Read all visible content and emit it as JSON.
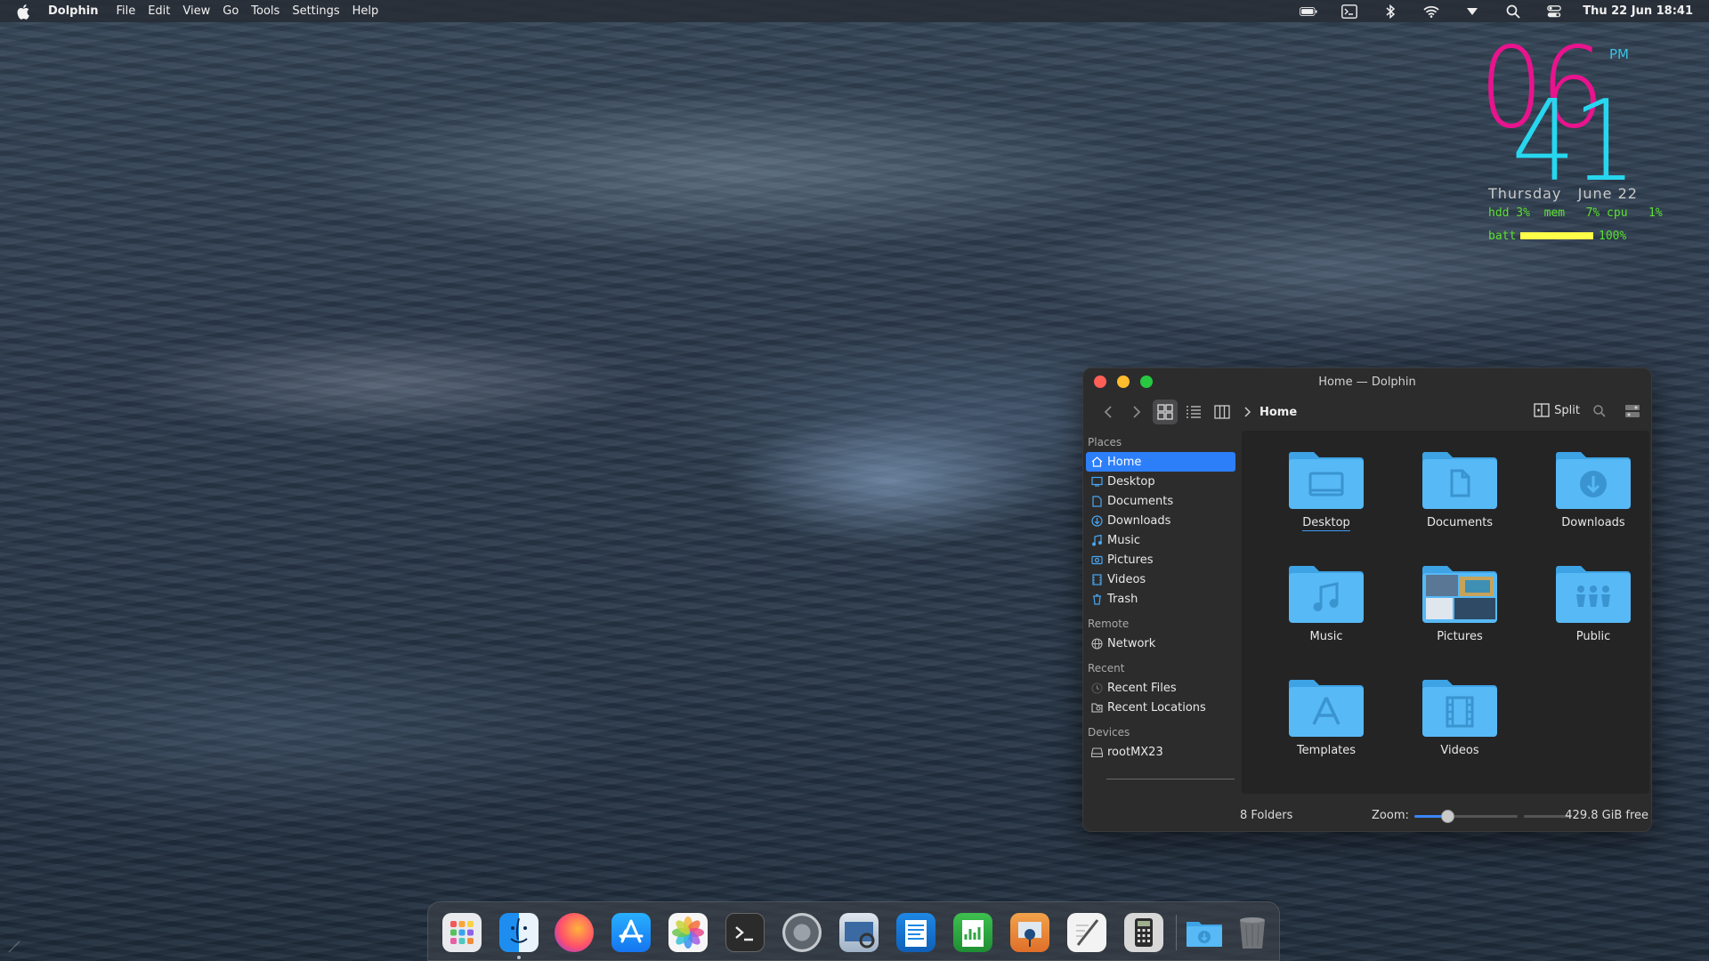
{
  "menubar": {
    "app_name": "Dolphin",
    "menus": [
      "File",
      "Edit",
      "View",
      "Go",
      "Tools",
      "Settings",
      "Help"
    ],
    "status_icons": [
      "battery-icon",
      "terminal-icon",
      "bluetooth-icon",
      "wifi-icon",
      "dropdown-arrow-icon",
      "search-icon",
      "control-center-icon"
    ],
    "clock": "Thu 22 Jun 18:41"
  },
  "conky": {
    "hour": "06",
    "minute": "41",
    "ampm": "PM",
    "date": "Thursday   June 22",
    "stats": "hdd 3%  mem   7% cpu   1%",
    "batt_label": "batt",
    "batt_level": 1.0,
    "batt_pct": "100%",
    "colors": {
      "hour": "#e8138d",
      "minute": "#27d7ef",
      "stats": "#5be12f",
      "battbar": "#ffff4a"
    }
  },
  "window": {
    "title": "Home — Dolphin",
    "breadcrumb": "Home",
    "split_label": "Split",
    "places_label": "Places",
    "places": [
      "Home",
      "Desktop",
      "Documents",
      "Downloads",
      "Music",
      "Pictures",
      "Videos",
      "Trash"
    ],
    "remote_label": "Remote",
    "remote": [
      "Network"
    ],
    "recent_label": "Recent",
    "recent": [
      "Recent Files",
      "Recent Locations"
    ],
    "devices_label": "Devices",
    "devices": [
      "rootMX23"
    ],
    "folders": [
      "Desktop",
      "Documents",
      "Downloads",
      "Music",
      "Pictures",
      "Public",
      "Templates",
      "Videos"
    ],
    "status_count": "8 Folders",
    "zoom_label": "Zoom:",
    "zoom_level": 0.32,
    "free_space": "429.8 GiB free"
  },
  "dock": {
    "apps": [
      "launchpad",
      "finder",
      "firefox",
      "app-store",
      "photos",
      "terminal",
      "system-settings",
      "preview",
      "pages",
      "numbers",
      "keynote",
      "textedit",
      "calculator",
      "downloads-folder",
      "trash"
    ]
  },
  "accent": "#2d7ff9"
}
